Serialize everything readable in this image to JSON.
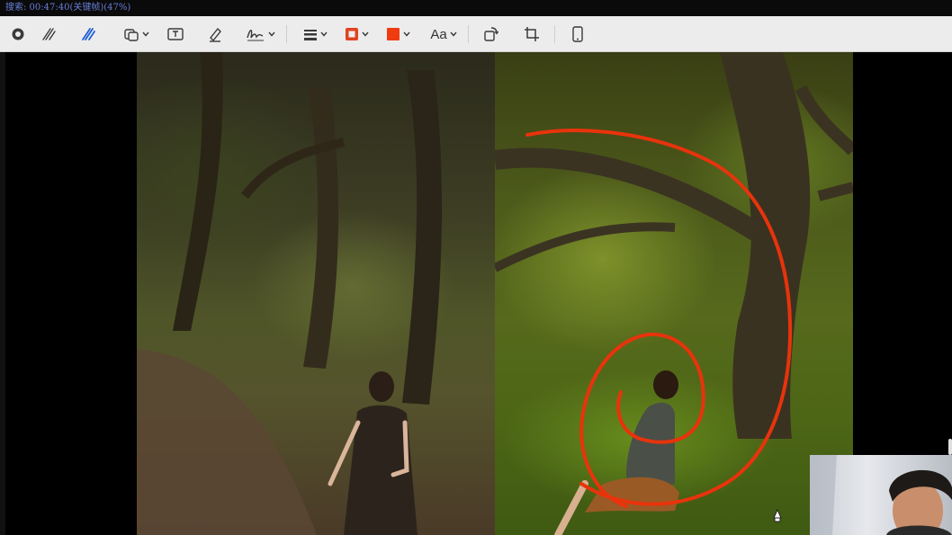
{
  "status": {
    "text": "搜索: 00:47:40(关键帧)(47%)",
    "color": "#6a7fd8"
  },
  "toolbar": {
    "tools": [
      {
        "name": "record-icon"
      },
      {
        "name": "sketch-icon"
      },
      {
        "name": "draw-icon",
        "selected": true
      },
      {
        "name": "shapes-icon"
      },
      {
        "name": "text-box-icon"
      },
      {
        "name": "highlight-icon"
      },
      {
        "name": "signature-icon"
      },
      {
        "name": "line-style-icon"
      },
      {
        "name": "border-color-icon",
        "color": "#e0421f"
      },
      {
        "name": "fill-color-icon",
        "color": "#f03a10"
      },
      {
        "name": "rotate-icon"
      },
      {
        "name": "crop-icon"
      },
      {
        "name": "device-icon"
      }
    ],
    "font_label": "Aa",
    "accent": "#1f5fd6"
  },
  "annotation": {
    "stroke_color": "#e8330c"
  }
}
